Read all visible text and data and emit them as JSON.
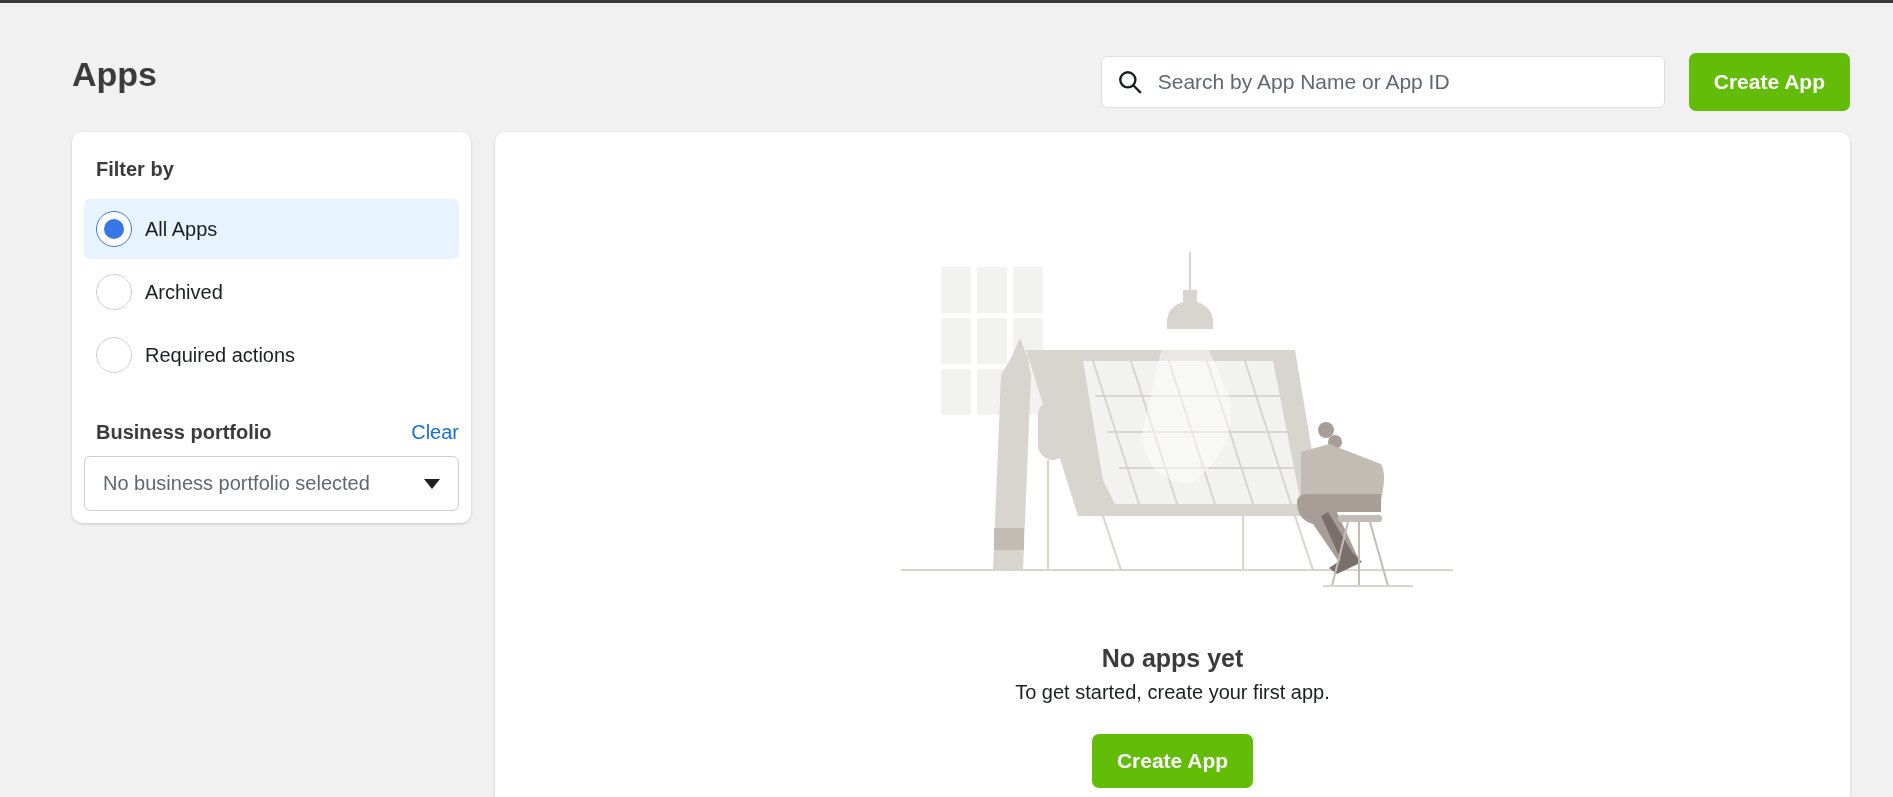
{
  "page": {
    "title": "Apps"
  },
  "search": {
    "placeholder": "Search by App Name or App ID"
  },
  "header_button": {
    "label": "Create App"
  },
  "filter": {
    "title": "Filter by",
    "options": [
      {
        "label": "All Apps",
        "selected": true
      },
      {
        "label": "Archived",
        "selected": false
      },
      {
        "label": "Required actions",
        "selected": false
      }
    ]
  },
  "business_portfolio": {
    "title": "Business portfolio",
    "clear_label": "Clear",
    "placeholder": "No business portfolio selected"
  },
  "empty_state": {
    "title": "No apps yet",
    "message": "To get started, create your first app.",
    "button": "Create App"
  }
}
